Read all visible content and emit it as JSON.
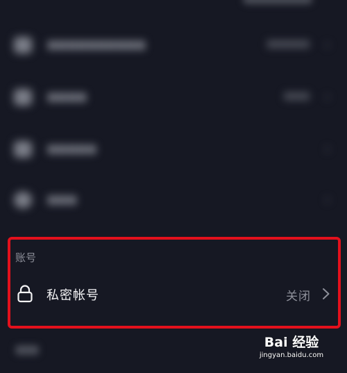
{
  "section": {
    "title": "账号"
  },
  "privacy_row": {
    "icon": "lock-icon",
    "label": "私密帐号",
    "value": "关闭"
  },
  "watermark": {
    "logo_text": "Bai 经验",
    "url": "jingyan.baidu.com"
  },
  "colors": {
    "background": "#161823",
    "highlight": "#e3101c",
    "primary_text": "#f3f3f5",
    "secondary_text": "#8e909a"
  }
}
